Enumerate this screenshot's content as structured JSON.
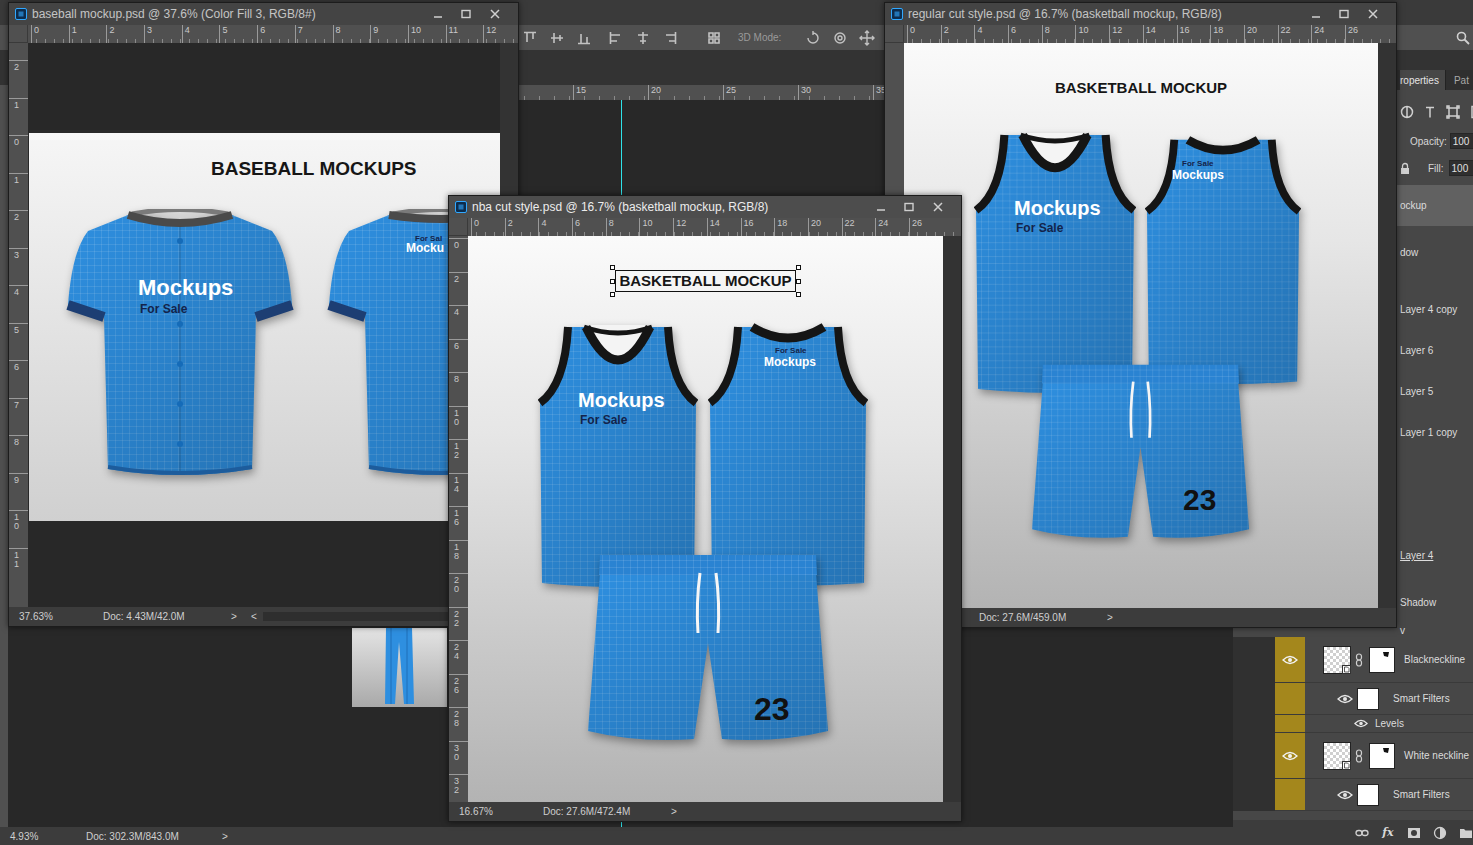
{
  "options_bar": {
    "mode_label": "3D Mode:"
  },
  "background_document": {
    "ruler_ticks": [
      "15",
      "20",
      "25",
      "30",
      "35"
    ],
    "status": {
      "zoom": "4.93%",
      "doc": "Doc: 302.3M/843.0M",
      "arrow": ">"
    }
  },
  "windows": [
    {
      "title": "baseball mockup.psd @ 37.6% (Color Fill 3, RGB/8#)",
      "active": false,
      "h_ruler": [
        "0",
        "1",
        "2",
        "3",
        "4",
        "5",
        "6",
        "7",
        "8",
        "9",
        "10",
        "11",
        "12"
      ],
      "v_ruler": [
        "2",
        "1",
        "0",
        "1",
        "2",
        "3",
        "4",
        "5",
        "6",
        "7",
        "8",
        "9",
        "10",
        "11"
      ],
      "canvas": {
        "kind": "baseball",
        "heading": {
          "text": "BASEBALL MOCKUPS",
          "selected": false
        },
        "garments": [
          {
            "kind": "tee-front",
            "prints": [
              {
                "text": "Mockups",
                "kind": "main"
              },
              {
                "text": "For Sale",
                "kind": "sub"
              }
            ]
          },
          {
            "kind": "tee-back",
            "prints": [
              {
                "text": "For Sal",
                "kind": "sub"
              },
              {
                "text": "Mocku",
                "kind": "main"
              }
            ]
          }
        ]
      },
      "status": {
        "zoom": "37.63%",
        "doc": "Doc: 4.43M/42.0M",
        "arrow": ">",
        "scroll": "<"
      }
    },
    {
      "title": "regular cut style.psd @ 16.7% (basketball mockup, RGB/8)",
      "active": false,
      "h_ruler": [
        "0",
        "2",
        "4",
        "6",
        "8",
        "10",
        "12",
        "14",
        "16",
        "18",
        "20",
        "22",
        "24",
        "26"
      ],
      "v_ruler": [],
      "canvas": {
        "kind": "regular-cut",
        "heading": {
          "text": "BASKETBALL MOCKUP",
          "selected": false
        },
        "garments": [
          {
            "kind": "tank-front",
            "prints": [
              {
                "text": "Mockups",
                "kind": "main"
              },
              {
                "text": "For Sale",
                "kind": "sub"
              }
            ]
          },
          {
            "kind": "tank-back",
            "prints": [
              {
                "text": "For Sale",
                "kind": "sub"
              },
              {
                "text": "Mockups",
                "kind": "main"
              }
            ]
          },
          {
            "kind": "shorts",
            "prints": [
              {
                "text": "23",
                "kind": "number"
              }
            ]
          }
        ]
      },
      "status": {
        "doc": "Doc: 27.6M/459.0M",
        "arrow": ">"
      }
    },
    {
      "title": "nba cut style.psd @ 16.7% (basketball mockup, RGB/8)",
      "active": true,
      "h_ruler": [
        "0",
        "2",
        "4",
        "6",
        "8",
        "10",
        "12",
        "14",
        "16",
        "18",
        "20",
        "22",
        "24",
        "26"
      ],
      "v_ruler": [
        "0",
        "2",
        "4",
        "6",
        "8",
        "10",
        "12",
        "14",
        "16",
        "18",
        "20",
        "22",
        "24",
        "26",
        "28",
        "30",
        "32"
      ],
      "canvas": {
        "kind": "nba-cut",
        "heading": {
          "text": "BASKETBALL MOCKUP",
          "selected": true
        },
        "garments": [
          {
            "kind": "tank-front",
            "prints": [
              {
                "text": "Mockups",
                "kind": "main"
              },
              {
                "text": "For Sale",
                "kind": "sub"
              }
            ]
          },
          {
            "kind": "tank-back",
            "prints": [
              {
                "text": "For Sale",
                "kind": "sub"
              },
              {
                "text": "Mockups",
                "kind": "main"
              }
            ]
          },
          {
            "kind": "shorts",
            "prints": [
              {
                "text": "23",
                "kind": "number"
              }
            ]
          }
        ]
      },
      "status": {
        "zoom": "16.67%",
        "doc": "Doc: 27.6M/472.4M",
        "arrow": ">"
      }
    }
  ],
  "panel": {
    "tabs": [
      {
        "label": "roperties",
        "selected": true
      },
      {
        "label": "Pat",
        "selected": false
      }
    ],
    "opacity": {
      "label": "Opacity:",
      "value": "100"
    },
    "fill": {
      "label": "Fill:",
      "value": "100"
    },
    "layers": [
      {
        "name": "ockup",
        "selected": true,
        "underlined": false
      },
      {
        "name": "dow",
        "selected": false,
        "underlined": false
      },
      {
        "name": "Layer 4 copy",
        "selected": false,
        "underlined": false
      },
      {
        "name": "Layer 6",
        "selected": false,
        "underlined": false
      },
      {
        "name": "Layer 5",
        "selected": false,
        "underlined": false
      },
      {
        "name": "Layer 1 copy",
        "selected": false,
        "underlined": false
      },
      {
        "name": "Layer 4",
        "selected": false,
        "underlined": true
      },
      {
        "name": "Shadow",
        "selected": false,
        "underlined": false
      },
      {
        "name": "v",
        "selected": false,
        "underlined": false
      }
    ],
    "group_layers": [
      {
        "name": "Blackneckline",
        "kind": "layer",
        "visible": true
      },
      {
        "name": "Smart Filters",
        "kind": "filter-mask",
        "visible": true
      },
      {
        "name": "Levels",
        "kind": "filter",
        "visible": true
      },
      {
        "name": "White neckline",
        "kind": "layer",
        "visible": true
      },
      {
        "name": "Smart Filters",
        "kind": "filter-mask",
        "visible": true
      }
    ],
    "footer": [
      {
        "kind": "link"
      },
      {
        "kind": "fx",
        "label": "fx"
      },
      {
        "kind": "mask"
      },
      {
        "kind": "adjustment"
      },
      {
        "kind": "folder"
      }
    ]
  }
}
